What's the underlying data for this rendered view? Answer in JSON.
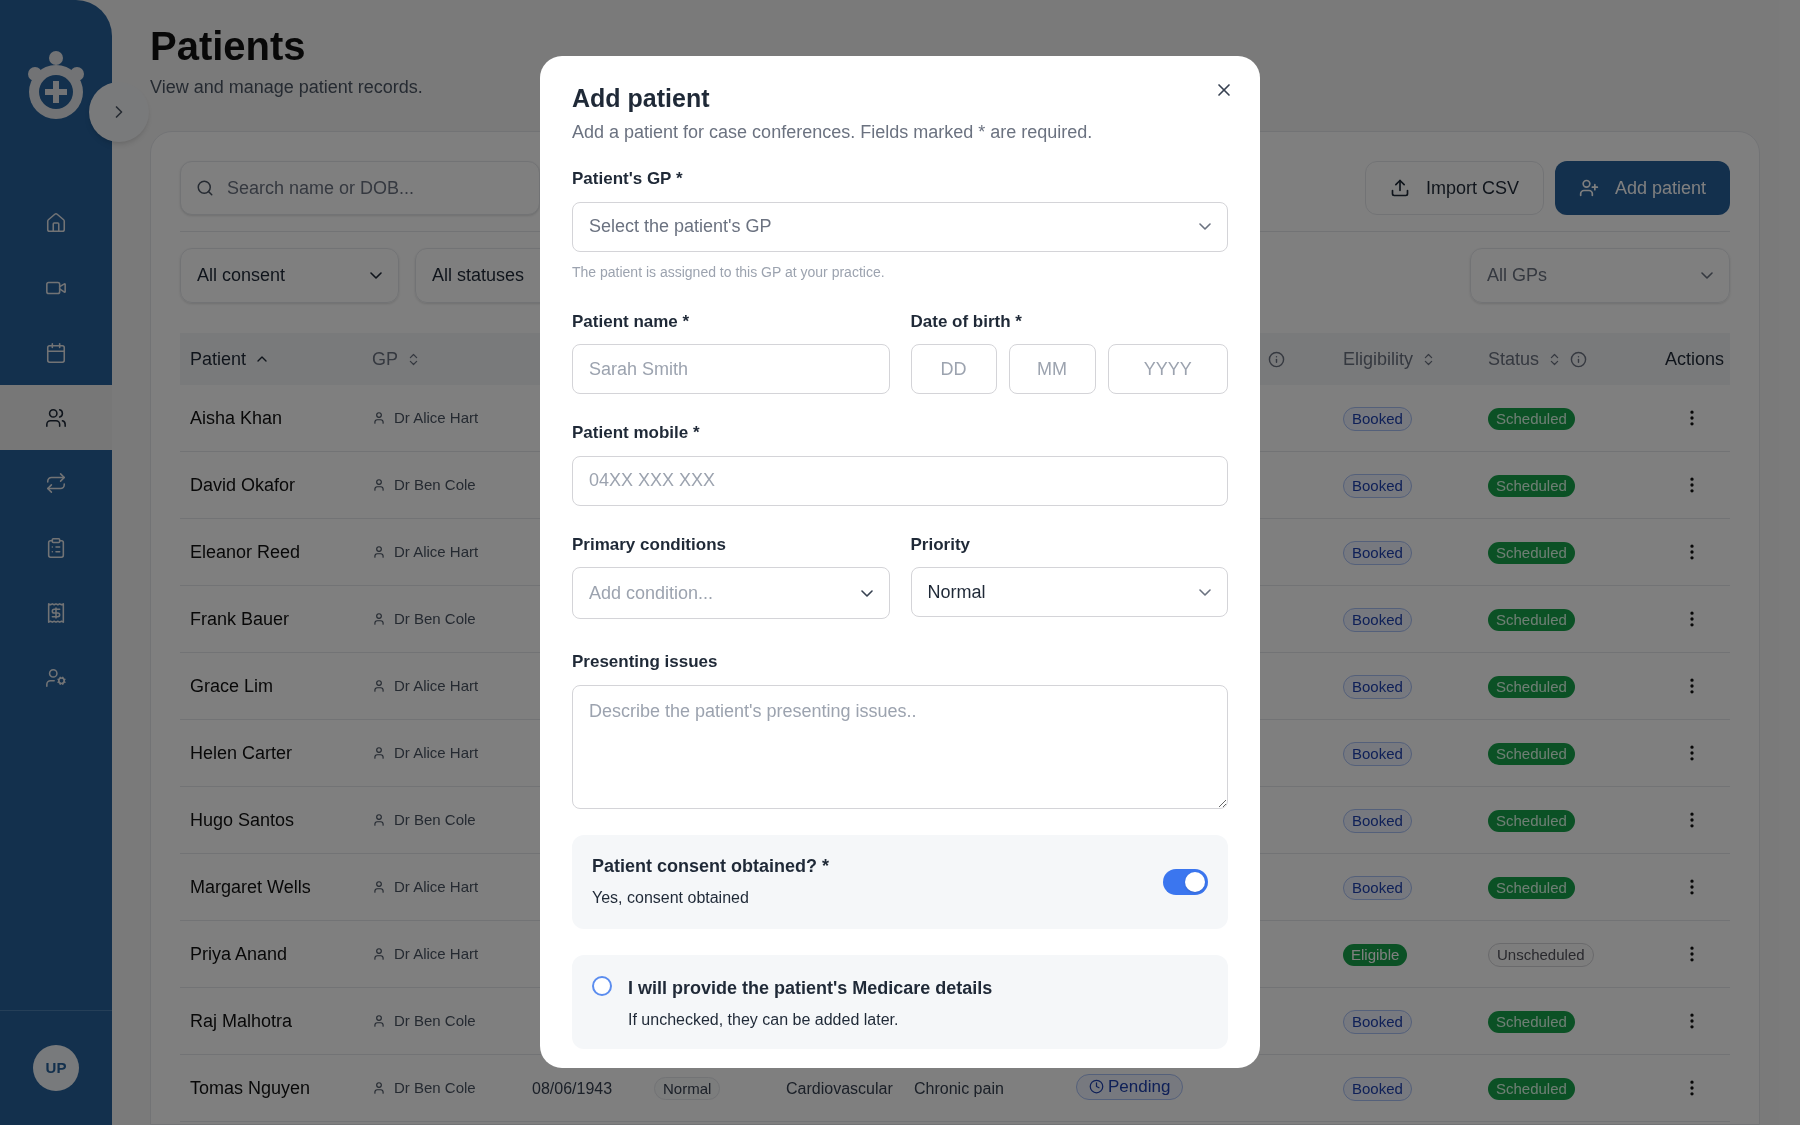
{
  "sidebar": {
    "nav": [
      {
        "selected": false
      },
      {
        "selected": false
      },
      {
        "selected": false
      },
      {
        "selected": true
      },
      {
        "selected": false
      },
      {
        "selected": false
      },
      {
        "selected": false
      },
      {
        "selected": false
      }
    ],
    "avatar": "UP"
  },
  "page": {
    "title": "Patients",
    "subtitle": "View and manage patient records."
  },
  "toolbar": {
    "search": {
      "placeholder": "Search name or DOB..."
    },
    "buttons": [
      {
        "label": "Import CSV",
        "kind": "secondary"
      },
      {
        "label": "Add patient",
        "kind": "primary"
      }
    ]
  },
  "filters": [
    {
      "value": "All consent",
      "chevron": true
    },
    {
      "value": "All statuses"
    },
    {
      "value": "All GPs",
      "chevron": true
    }
  ],
  "table": {
    "columns": [
      {
        "label": "Patient",
        "sortable": true,
        "sorted": true
      },
      {
        "label": "GP",
        "sortable": true,
        "sorted": false
      },
      {
        "info": true
      },
      {
        "label": "Eligibility",
        "sortable": true,
        "sorted": false
      },
      {
        "label": "Status",
        "sortable": true,
        "sorted": false,
        "info": true
      },
      {
        "label": "Actions"
      }
    ],
    "rows": [
      {
        "patient": "Aisha Khan",
        "gp": "Dr Alice Hart",
        "eligibility": {
          "label": "Booked",
          "kind": "booked"
        },
        "status": {
          "label": "Scheduled",
          "kind": "scheduled"
        }
      },
      {
        "patient": "David Okafor",
        "gp": "Dr Ben Cole",
        "eligibility": {
          "label": "Booked",
          "kind": "booked"
        },
        "status": {
          "label": "Scheduled",
          "kind": "scheduled"
        }
      },
      {
        "patient": "Eleanor Reed",
        "gp": "Dr Alice Hart",
        "eligibility": {
          "label": "Booked",
          "kind": "booked"
        },
        "status": {
          "label": "Scheduled",
          "kind": "scheduled"
        }
      },
      {
        "patient": "Frank Bauer",
        "gp": "Dr Ben Cole",
        "eligibility": {
          "label": "Booked",
          "kind": "booked"
        },
        "status": {
          "label": "Scheduled",
          "kind": "scheduled"
        }
      },
      {
        "patient": "Grace Lim",
        "gp": "Dr Alice Hart",
        "eligibility": {
          "label": "Booked",
          "kind": "booked"
        },
        "status": {
          "label": "Scheduled",
          "kind": "scheduled"
        }
      },
      {
        "patient": "Helen Carter",
        "gp": "Dr Alice Hart",
        "eligibility": {
          "label": "Booked",
          "kind": "booked"
        },
        "status": {
          "label": "Scheduled",
          "kind": "scheduled"
        }
      },
      {
        "patient": "Hugo Santos",
        "gp": "Dr Ben Cole",
        "eligibility": {
          "label": "Booked",
          "kind": "booked"
        },
        "status": {
          "label": "Scheduled",
          "kind": "scheduled"
        }
      },
      {
        "patient": "Margaret Wells",
        "gp": "Dr Alice Hart",
        "eligibility": {
          "label": "Booked",
          "kind": "booked"
        },
        "status": {
          "label": "Scheduled",
          "kind": "scheduled"
        }
      },
      {
        "patient": "Priya Anand",
        "gp": "Dr Alice Hart",
        "eligibility": {
          "label": "Eligible",
          "kind": "eligible"
        },
        "status": {
          "label": "Unscheduled",
          "kind": "unscheduled"
        }
      },
      {
        "patient": "Raj Malhotra",
        "gp": "Dr Ben Cole",
        "eligibility": {
          "label": "Booked",
          "kind": "booked"
        },
        "status": {
          "label": "Scheduled",
          "kind": "scheduled"
        }
      },
      {
        "patient": "Tomas Nguyen",
        "gp": "Dr Ben Cole",
        "dob": "08/06/1943",
        "priority": "Normal",
        "conditions": [
          "Cardiovascular",
          "Chronic pain"
        ],
        "consent": {
          "label": "Pending",
          "kind": "pending"
        },
        "eligibility": {
          "label": "Booked",
          "kind": "booked"
        },
        "status": {
          "label": "Scheduled",
          "kind": "scheduled"
        }
      }
    ]
  },
  "dialog": {
    "title": "Add patient",
    "subtitle": "Add a patient for case conferences. Fields marked * are required.",
    "gp": {
      "label": "Patient's GP *",
      "placeholder": "Select the patient's GP",
      "hint": "The patient is assigned to this GP at your practice."
    },
    "name": {
      "label": "Patient name *",
      "placeholder": "Sarah Smith"
    },
    "dob": {
      "label": "Date of birth *",
      "parts": [
        {
          "placeholder": "DD"
        },
        {
          "placeholder": "MM"
        },
        {
          "placeholder": "YYYY"
        }
      ]
    },
    "mobile": {
      "label": "Patient mobile *",
      "placeholder": "04XX XXX XXX"
    },
    "conditions": {
      "label": "Primary conditions",
      "placeholder": "Add condition..."
    },
    "priority": {
      "label": "Priority",
      "value": "Normal"
    },
    "issues": {
      "label": "Presenting issues",
      "placeholder": "Describe the patient's presenting issues.."
    },
    "consent": {
      "title": "Patient consent obtained? *",
      "subtitle": "Yes, consent obtained",
      "on": true
    },
    "medicare": {
      "title": "I will provide the patient's Medicare details",
      "subtitle": "If unchecked, they can be added later.",
      "checked": false
    }
  }
}
